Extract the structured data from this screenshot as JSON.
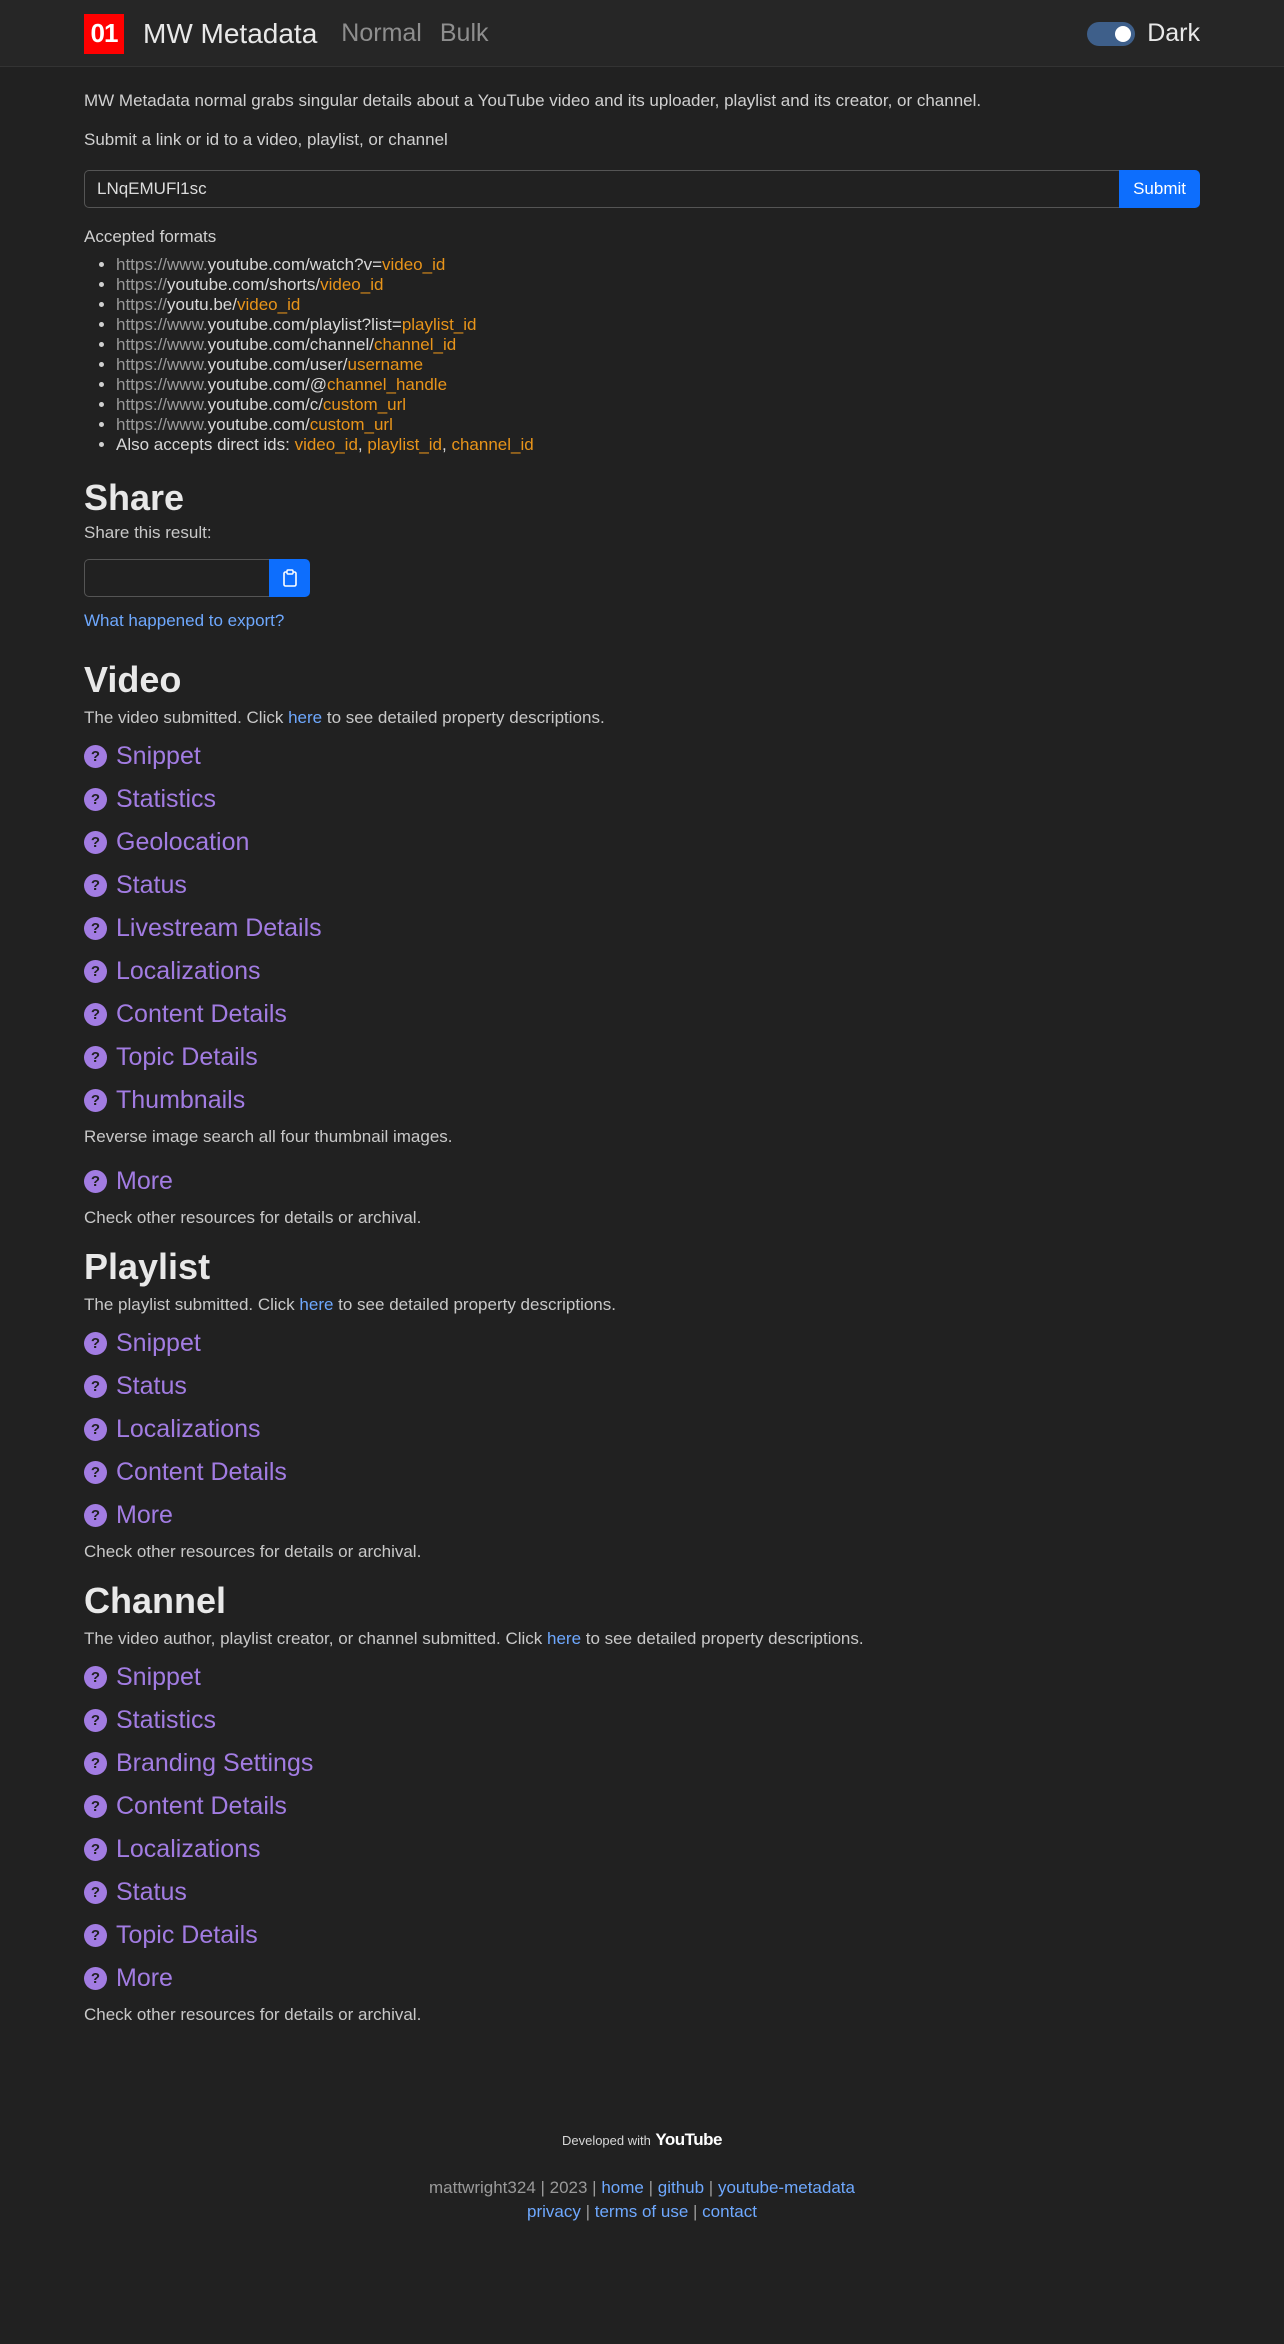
{
  "nav": {
    "logo_text": "01",
    "brand": "MW Metadata",
    "links": [
      "Normal",
      "Bulk"
    ],
    "theme_label": "Dark",
    "theme_on": true
  },
  "intro": "MW Metadata normal grabs singular details about a YouTube video and its uploader, playlist and its creator, or channel.",
  "submit_label": "Submit a link or id to a video, playlist, or channel",
  "input_value": "LNqEMUFl1sc",
  "submit_button": "Submit",
  "accepted_label": "Accepted formats",
  "formats": [
    [
      {
        "t": "https://www.",
        "c": "gray"
      },
      {
        "t": "youtube.com/watch?v=",
        "c": "white"
      },
      {
        "t": "video_id",
        "c": "orange"
      }
    ],
    [
      {
        "t": "https://",
        "c": "gray"
      },
      {
        "t": "youtube.com/shorts/",
        "c": "white"
      },
      {
        "t": "video_id",
        "c": "orange"
      }
    ],
    [
      {
        "t": "https://",
        "c": "gray"
      },
      {
        "t": "youtu.be/",
        "c": "white"
      },
      {
        "t": "video_id",
        "c": "orange"
      }
    ],
    [
      {
        "t": "https://www.",
        "c": "gray"
      },
      {
        "t": "youtube.com/playlist?list=",
        "c": "white"
      },
      {
        "t": "playlist_id",
        "c": "orange"
      }
    ],
    [
      {
        "t": "https://www.",
        "c": "gray"
      },
      {
        "t": "youtube.com/channel/",
        "c": "white"
      },
      {
        "t": "channel_id",
        "c": "orange"
      }
    ],
    [
      {
        "t": "https://www.",
        "c": "gray"
      },
      {
        "t": "youtube.com/user/",
        "c": "white"
      },
      {
        "t": "username",
        "c": "orange"
      }
    ],
    [
      {
        "t": "https://www.",
        "c": "gray"
      },
      {
        "t": "youtube.com/@",
        "c": "white"
      },
      {
        "t": "channel_handle",
        "c": "orange"
      }
    ],
    [
      {
        "t": "https://www.",
        "c": "gray"
      },
      {
        "t": "youtube.com/c/",
        "c": "white"
      },
      {
        "t": "custom_url",
        "c": "orange"
      }
    ],
    [
      {
        "t": "https://www.",
        "c": "gray"
      },
      {
        "t": "youtube.com/",
        "c": "white"
      },
      {
        "t": "custom_url",
        "c": "orange"
      }
    ],
    [
      {
        "t": "Also accepts direct ids: ",
        "c": "white"
      },
      {
        "t": "video_id",
        "c": "orange"
      },
      {
        "t": ", ",
        "c": "white"
      },
      {
        "t": "playlist_id",
        "c": "orange"
      },
      {
        "t": ", ",
        "c": "white"
      },
      {
        "t": "channel_id",
        "c": "orange"
      }
    ]
  ],
  "share": {
    "title": "Share",
    "subtitle": "Share this result:",
    "export_link": "What happened to export?"
  },
  "video": {
    "title": "Video",
    "desc_pre": "The video submitted. Click ",
    "desc_link": "here",
    "desc_post": " to see detailed property descriptions.",
    "items": [
      "Snippet",
      "Statistics",
      "Geolocation",
      "Status",
      "Livestream Details",
      "Localizations",
      "Content Details",
      "Topic Details",
      "Thumbnails"
    ],
    "thumb_note": "Reverse image search all four thumbnail images.",
    "more": "More",
    "more_note": "Check other resources for details or archival."
  },
  "playlist": {
    "title": "Playlist",
    "desc_pre": "The playlist submitted. Click ",
    "desc_link": "here",
    "desc_post": " to see detailed property descriptions.",
    "items": [
      "Snippet",
      "Status",
      "Localizations",
      "Content Details",
      "More"
    ],
    "more_note": "Check other resources for details or archival."
  },
  "channel": {
    "title": "Channel",
    "desc_pre": "The video author, playlist creator, or channel submitted. Click ",
    "desc_link": "here",
    "desc_post": " to see detailed property descriptions.",
    "items": [
      "Snippet",
      "Statistics",
      "Branding Settings",
      "Content Details",
      "Localizations",
      "Status",
      "Topic Details",
      "More"
    ],
    "more_note": "Check other resources for details or archival."
  },
  "footer": {
    "developed_with": "Developed with",
    "youtube": "YouTube",
    "credit": "mattwright324 | 2023 |",
    "links_row1": [
      "home",
      "github",
      "youtube-metadata"
    ],
    "links_row2": [
      "privacy",
      "terms of use",
      "contact"
    ]
  },
  "colors": {
    "background": "#212121",
    "accent_purple": "#a27ce2",
    "primary_blue": "#0d6efd",
    "link_blue": "#6ea8fe",
    "orange": "#e8941a",
    "logo_red": "#ff0000"
  }
}
